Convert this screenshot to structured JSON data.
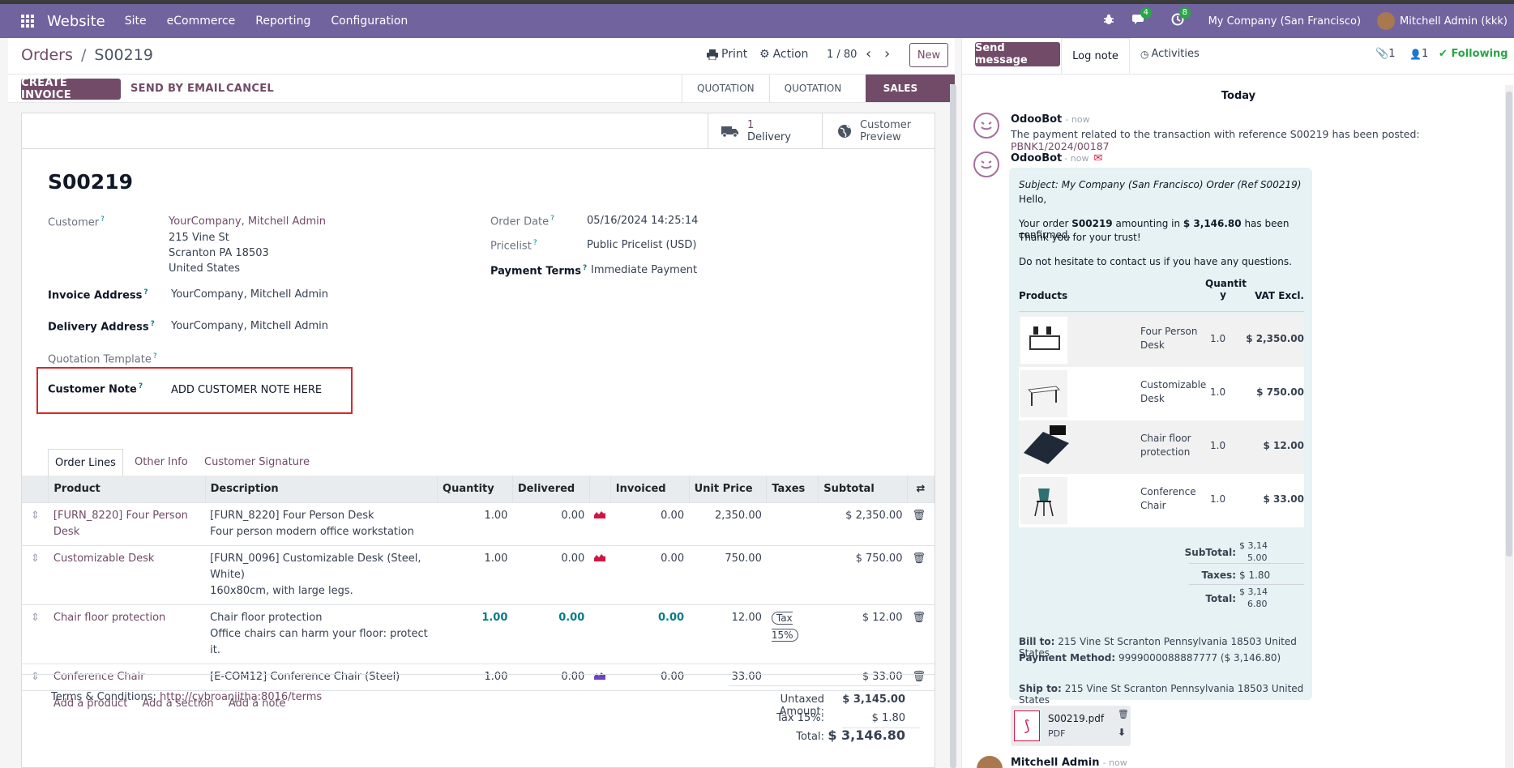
{
  "navbar": {
    "brand": "Website",
    "menus": [
      "Site",
      "eCommerce",
      "Reporting",
      "Configuration"
    ],
    "messages_count": "4",
    "activities_count": "8",
    "company": "My Company (San Francisco)",
    "user": "Mitchell Admin (kkk)"
  },
  "control_panel": {
    "breadcrumb_parent": "Orders",
    "breadcrumb_sep": "/",
    "breadcrumb_current": "S00219",
    "print": "Print",
    "action": "Action",
    "pager": "1 / 80",
    "new": "New"
  },
  "statusbar": {
    "buttons": [
      "CREATE INVOICE",
      "SEND BY EMAIL",
      "CANCEL"
    ],
    "stages": [
      "QUOTATION",
      "QUOTATION SENT",
      "SALES ORDER"
    ],
    "active_stage_color": "#714b67"
  },
  "smart_buttons": {
    "delivery_count": "1",
    "delivery_label": "Delivery",
    "preview_line1": "Customer",
    "preview_line2": "Preview"
  },
  "form": {
    "name": "S00219",
    "customer_label": "Customer",
    "customer_name": "YourCompany, Mitchell Admin",
    "customer_addr1": "215 Vine St",
    "customer_addr2": "Scranton PA 18503",
    "customer_addr3": "United States",
    "invoice_address_label": "Invoice Address",
    "invoice_address": "YourCompany, Mitchell Admin",
    "delivery_address_label": "Delivery Address",
    "delivery_address": "YourCompany, Mitchell Admin",
    "quotation_template_label": "Quotation Template",
    "customer_note_label": "Customer Note",
    "customer_note_value": "ADD CUSTOMER NOTE HERE",
    "order_date_label": "Order Date",
    "order_date": "05/16/2024 14:25:14",
    "pricelist_label": "Pricelist",
    "pricelist": "Public Pricelist (USD)",
    "payment_terms_label": "Payment Terms",
    "payment_terms": "Immediate Payment"
  },
  "tabs": [
    "Order Lines",
    "Other Info",
    "Customer Signature"
  ],
  "lines": {
    "headers": [
      "Product",
      "Description",
      "Quantity",
      "Delivered",
      "Invoiced",
      "Unit Price",
      "Taxes",
      "Subtotal"
    ],
    "rows": [
      {
        "product": "[FURN_8220] Four Person Desk",
        "desc1": "[FURN_8220] Four Person Desk",
        "desc2": "Four person modern office workstation",
        "qty": "1.00",
        "delivered": "0.00",
        "invoiced": "0.00",
        "price": "2,350.00",
        "tax": "",
        "subtotal": "$ 2,350.00"
      },
      {
        "product": "Customizable Desk",
        "desc1": "[FURN_0096] Customizable Desk (Steel, White)",
        "desc2": "160x80cm, with large legs.",
        "qty": "1.00",
        "delivered": "0.00",
        "invoiced": "0.00",
        "price": "750.00",
        "tax": "",
        "subtotal": "$ 750.00"
      },
      {
        "product": "Chair floor protection",
        "desc1": "Chair floor protection",
        "desc2": "Office chairs can harm your floor: protect it.",
        "qty": "1.00",
        "delivered": "0.00",
        "invoiced": "0.00",
        "price": "12.00",
        "tax": "Tax 15%",
        "subtotal": "$ 12.00"
      },
      {
        "product": "Conference Chair",
        "desc1": "[E-COM12] Conference Chair (Steel)",
        "desc2": "",
        "qty": "1.00",
        "delivered": "0.00",
        "invoiced": "0.00",
        "price": "33.00",
        "tax": "",
        "subtotal": "$ 33.00"
      }
    ],
    "add_product": "Add a product",
    "add_section": "Add a section",
    "add_note": "Add a note"
  },
  "footer": {
    "terms_label": "Terms & Conditions:",
    "terms_link": "http://cybroanjitha:8016/terms",
    "untaxed_label": "Untaxed Amount:",
    "untaxed": "$ 3,145.00",
    "tax_label": "Tax 15%:",
    "tax": "$ 1.80",
    "total_label": "Total:",
    "total": "$ 3,146.80"
  },
  "chatter": {
    "send_message": "Send message",
    "log_note": "Log note",
    "activities": "Activities",
    "attachments_count": "1",
    "followers_count": "1",
    "following": "Following",
    "today": "Today",
    "msg1_author": "OdooBot",
    "msg1_time": "- now",
    "msg1_text": "The payment related to the transaction with reference S00219 has been posted:",
    "msg1_link": "PBNK1/2024/00187",
    "msg2_author": "OdooBot",
    "msg2_time": "- now",
    "subject": "Subject: My Company (San Francisco) Order (Ref S00219)",
    "hello": "Hello,",
    "order_pre": "Your order ",
    "order_ref": "S00219",
    "order_mid": " amounting in ",
    "order_amount": "$ 3,146.80",
    "order_post": " has been confirmed.",
    "thanks": "Thank you for your trust!",
    "contact": "Do not hesitate to contact us if you have any questions.",
    "col_products": "Products",
    "col_qty_1": "Quantit",
    "col_qty_2": "y",
    "col_vat": "VAT Excl.",
    "items": [
      {
        "name1": "Four Person",
        "name2": "Desk",
        "qty": "1.0",
        "price": "$ 2,350.00"
      },
      {
        "name1": "Customizable",
        "name2": "Desk",
        "qty": "1.0",
        "price": "$ 750.00"
      },
      {
        "name1": "Chair floor",
        "name2": "protection",
        "qty": "1.0",
        "price": "$ 12.00"
      },
      {
        "name1": "Conference",
        "name2": "Chair",
        "qty": "1.0",
        "price": "$ 33.00"
      }
    ],
    "subtotal_label": "SubTotal:",
    "subtotal_1": "$ 3,14",
    "subtotal_2": "5.00",
    "taxes_label": "Taxes:",
    "taxes": "$ 1.80",
    "total_label": "Total:",
    "total_1": "$ 3,14",
    "total_2": "6.80",
    "bill_to_label": "Bill to:",
    "bill_to": "215 Vine St Scranton Pennsylvania 18503 United States",
    "payment_method_label": "Payment Method:",
    "payment_method": "9999000088887777 ($ 3,146.80)",
    "ship_to_label": "Ship to:",
    "ship_to": "215 Vine St Scranton Pennsylvania 18503 United States",
    "attachment_name": "S00219.pdf",
    "attachment_type": "PDF",
    "msg3_author": "Mitchell Admin",
    "msg3_time": "- now"
  }
}
